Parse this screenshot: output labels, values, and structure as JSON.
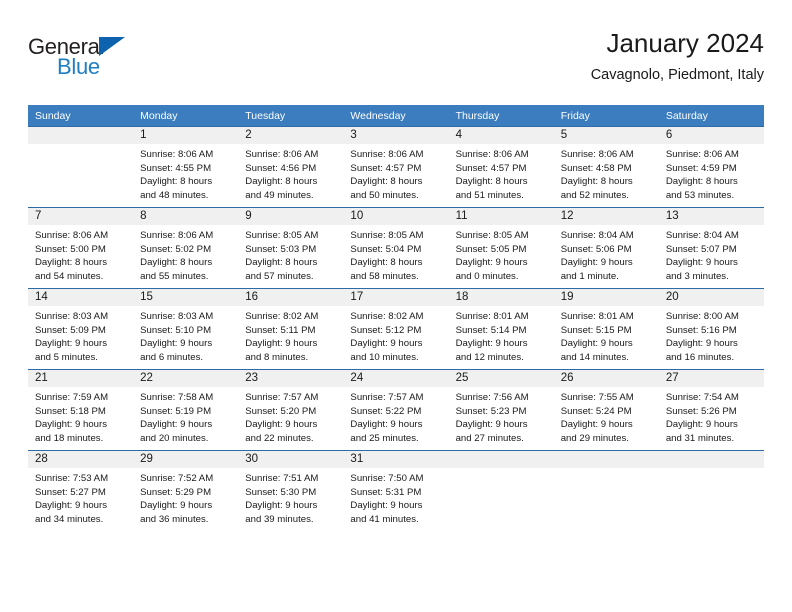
{
  "brand": {
    "name_part1": "General",
    "name_part2": "Blue",
    "logo_icon": "blue-triangle-logo"
  },
  "header": {
    "title": "January 2024",
    "subtitle": "Cavagnolo, Piedmont, Italy"
  },
  "colors": {
    "header_blue": "#3b7dbf",
    "row_divider_blue": "#2d6aa8",
    "daynum_bg": "#f0f0f0",
    "brand_blue": "#1f7ec4",
    "logo_blue": "#0d63ad"
  },
  "weekday_headers": [
    "Sunday",
    "Monday",
    "Tuesday",
    "Wednesday",
    "Thursday",
    "Friday",
    "Saturday"
  ],
  "weeks": [
    [
      {
        "day": "",
        "blank": true,
        "sunrise": "",
        "sunset": "",
        "daylight_line1": "",
        "daylight_line2": ""
      },
      {
        "day": "1",
        "sunrise": "Sunrise: 8:06 AM",
        "sunset": "Sunset: 4:55 PM",
        "daylight_line1": "Daylight: 8 hours",
        "daylight_line2": "and 48 minutes."
      },
      {
        "day": "2",
        "sunrise": "Sunrise: 8:06 AM",
        "sunset": "Sunset: 4:56 PM",
        "daylight_line1": "Daylight: 8 hours",
        "daylight_line2": "and 49 minutes."
      },
      {
        "day": "3",
        "sunrise": "Sunrise: 8:06 AM",
        "sunset": "Sunset: 4:57 PM",
        "daylight_line1": "Daylight: 8 hours",
        "daylight_line2": "and 50 minutes."
      },
      {
        "day": "4",
        "sunrise": "Sunrise: 8:06 AM",
        "sunset": "Sunset: 4:57 PM",
        "daylight_line1": "Daylight: 8 hours",
        "daylight_line2": "and 51 minutes."
      },
      {
        "day": "5",
        "sunrise": "Sunrise: 8:06 AM",
        "sunset": "Sunset: 4:58 PM",
        "daylight_line1": "Daylight: 8 hours",
        "daylight_line2": "and 52 minutes."
      },
      {
        "day": "6",
        "sunrise": "Sunrise: 8:06 AM",
        "sunset": "Sunset: 4:59 PM",
        "daylight_line1": "Daylight: 8 hours",
        "daylight_line2": "and 53 minutes."
      }
    ],
    [
      {
        "day": "7",
        "sunrise": "Sunrise: 8:06 AM",
        "sunset": "Sunset: 5:00 PM",
        "daylight_line1": "Daylight: 8 hours",
        "daylight_line2": "and 54 minutes."
      },
      {
        "day": "8",
        "sunrise": "Sunrise: 8:06 AM",
        "sunset": "Sunset: 5:02 PM",
        "daylight_line1": "Daylight: 8 hours",
        "daylight_line2": "and 55 minutes."
      },
      {
        "day": "9",
        "sunrise": "Sunrise: 8:05 AM",
        "sunset": "Sunset: 5:03 PM",
        "daylight_line1": "Daylight: 8 hours",
        "daylight_line2": "and 57 minutes."
      },
      {
        "day": "10",
        "sunrise": "Sunrise: 8:05 AM",
        "sunset": "Sunset: 5:04 PM",
        "daylight_line1": "Daylight: 8 hours",
        "daylight_line2": "and 58 minutes."
      },
      {
        "day": "11",
        "sunrise": "Sunrise: 8:05 AM",
        "sunset": "Sunset: 5:05 PM",
        "daylight_line1": "Daylight: 9 hours",
        "daylight_line2": "and 0 minutes."
      },
      {
        "day": "12",
        "sunrise": "Sunrise: 8:04 AM",
        "sunset": "Sunset: 5:06 PM",
        "daylight_line1": "Daylight: 9 hours",
        "daylight_line2": "and 1 minute."
      },
      {
        "day": "13",
        "sunrise": "Sunrise: 8:04 AM",
        "sunset": "Sunset: 5:07 PM",
        "daylight_line1": "Daylight: 9 hours",
        "daylight_line2": "and 3 minutes."
      }
    ],
    [
      {
        "day": "14",
        "sunrise": "Sunrise: 8:03 AM",
        "sunset": "Sunset: 5:09 PM",
        "daylight_line1": "Daylight: 9 hours",
        "daylight_line2": "and 5 minutes."
      },
      {
        "day": "15",
        "sunrise": "Sunrise: 8:03 AM",
        "sunset": "Sunset: 5:10 PM",
        "daylight_line1": "Daylight: 9 hours",
        "daylight_line2": "and 6 minutes."
      },
      {
        "day": "16",
        "sunrise": "Sunrise: 8:02 AM",
        "sunset": "Sunset: 5:11 PM",
        "daylight_line1": "Daylight: 9 hours",
        "daylight_line2": "and 8 minutes."
      },
      {
        "day": "17",
        "sunrise": "Sunrise: 8:02 AM",
        "sunset": "Sunset: 5:12 PM",
        "daylight_line1": "Daylight: 9 hours",
        "daylight_line2": "and 10 minutes."
      },
      {
        "day": "18",
        "sunrise": "Sunrise: 8:01 AM",
        "sunset": "Sunset: 5:14 PM",
        "daylight_line1": "Daylight: 9 hours",
        "daylight_line2": "and 12 minutes."
      },
      {
        "day": "19",
        "sunrise": "Sunrise: 8:01 AM",
        "sunset": "Sunset: 5:15 PM",
        "daylight_line1": "Daylight: 9 hours",
        "daylight_line2": "and 14 minutes."
      },
      {
        "day": "20",
        "sunrise": "Sunrise: 8:00 AM",
        "sunset": "Sunset: 5:16 PM",
        "daylight_line1": "Daylight: 9 hours",
        "daylight_line2": "and 16 minutes."
      }
    ],
    [
      {
        "day": "21",
        "sunrise": "Sunrise: 7:59 AM",
        "sunset": "Sunset: 5:18 PM",
        "daylight_line1": "Daylight: 9 hours",
        "daylight_line2": "and 18 minutes."
      },
      {
        "day": "22",
        "sunrise": "Sunrise: 7:58 AM",
        "sunset": "Sunset: 5:19 PM",
        "daylight_line1": "Daylight: 9 hours",
        "daylight_line2": "and 20 minutes."
      },
      {
        "day": "23",
        "sunrise": "Sunrise: 7:57 AM",
        "sunset": "Sunset: 5:20 PM",
        "daylight_line1": "Daylight: 9 hours",
        "daylight_line2": "and 22 minutes."
      },
      {
        "day": "24",
        "sunrise": "Sunrise: 7:57 AM",
        "sunset": "Sunset: 5:22 PM",
        "daylight_line1": "Daylight: 9 hours",
        "daylight_line2": "and 25 minutes."
      },
      {
        "day": "25",
        "sunrise": "Sunrise: 7:56 AM",
        "sunset": "Sunset: 5:23 PM",
        "daylight_line1": "Daylight: 9 hours",
        "daylight_line2": "and 27 minutes."
      },
      {
        "day": "26",
        "sunrise": "Sunrise: 7:55 AM",
        "sunset": "Sunset: 5:24 PM",
        "daylight_line1": "Daylight: 9 hours",
        "daylight_line2": "and 29 minutes."
      },
      {
        "day": "27",
        "sunrise": "Sunrise: 7:54 AM",
        "sunset": "Sunset: 5:26 PM",
        "daylight_line1": "Daylight: 9 hours",
        "daylight_line2": "and 31 minutes."
      }
    ],
    [
      {
        "day": "28",
        "sunrise": "Sunrise: 7:53 AM",
        "sunset": "Sunset: 5:27 PM",
        "daylight_line1": "Daylight: 9 hours",
        "daylight_line2": "and 34 minutes."
      },
      {
        "day": "29",
        "sunrise": "Sunrise: 7:52 AM",
        "sunset": "Sunset: 5:29 PM",
        "daylight_line1": "Daylight: 9 hours",
        "daylight_line2": "and 36 minutes."
      },
      {
        "day": "30",
        "sunrise": "Sunrise: 7:51 AM",
        "sunset": "Sunset: 5:30 PM",
        "daylight_line1": "Daylight: 9 hours",
        "daylight_line2": "and 39 minutes."
      },
      {
        "day": "31",
        "sunrise": "Sunrise: 7:50 AM",
        "sunset": "Sunset: 5:31 PM",
        "daylight_line1": "Daylight: 9 hours",
        "daylight_line2": "and 41 minutes."
      },
      {
        "day": "",
        "blank": true,
        "sunrise": "",
        "sunset": "",
        "daylight_line1": "",
        "daylight_line2": ""
      },
      {
        "day": "",
        "blank": true,
        "sunrise": "",
        "sunset": "",
        "daylight_line1": "",
        "daylight_line2": ""
      },
      {
        "day": "",
        "blank": true,
        "sunrise": "",
        "sunset": "",
        "daylight_line1": "",
        "daylight_line2": ""
      }
    ]
  ]
}
